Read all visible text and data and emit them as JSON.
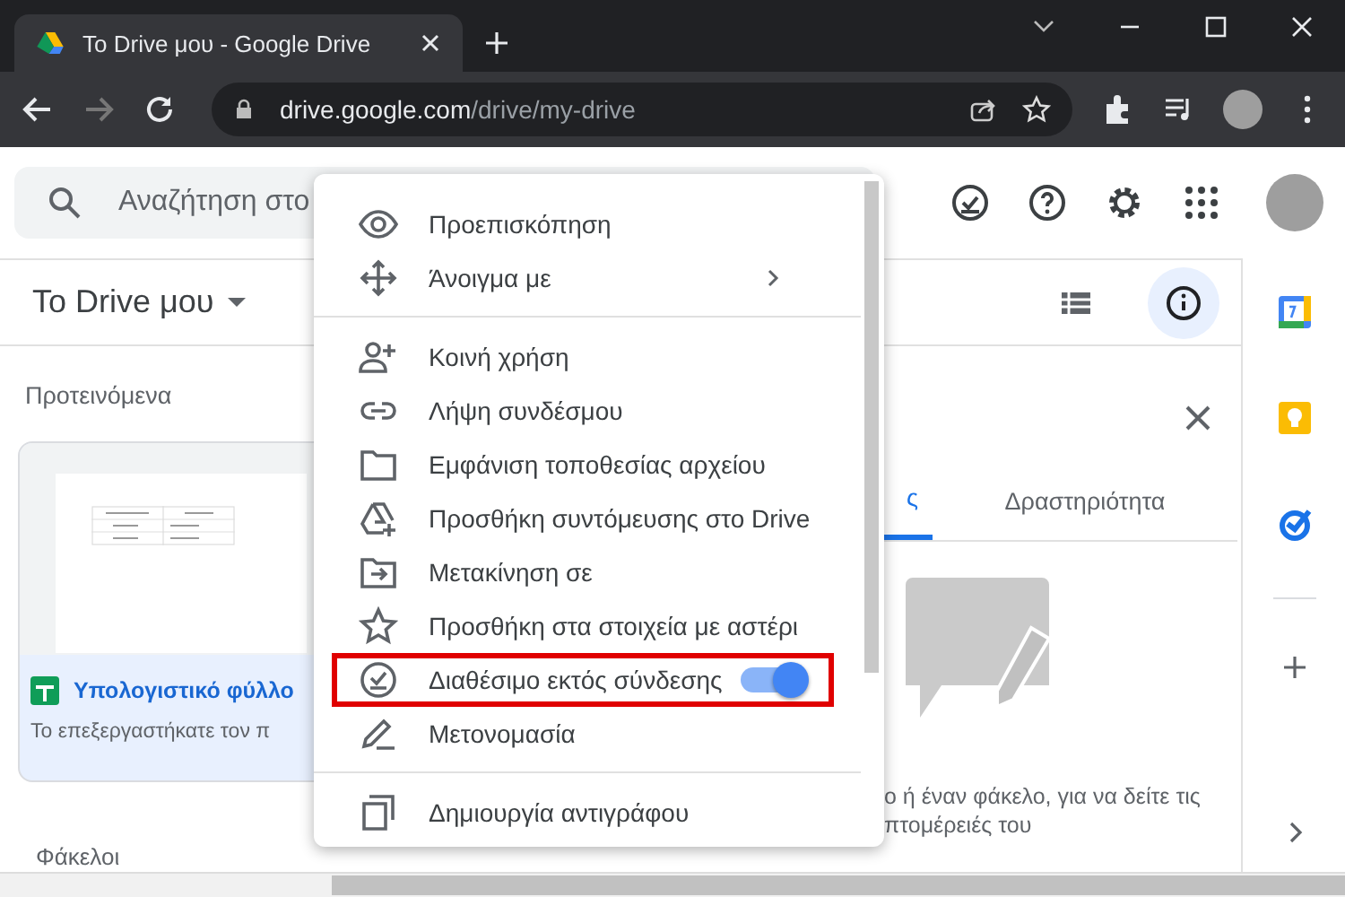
{
  "browser": {
    "tabs": [
      {
        "title": "Το Drive μου - Google Drive",
        "selected": true
      }
    ],
    "address": {
      "domain": "drive.google.com",
      "path": "/drive/my-drive"
    }
  },
  "drive": {
    "search": {
      "placeholder": "Αναζήτηση στο"
    },
    "breadcrumb": "Το Drive μου",
    "suggested_heading": "Προτεινόμενα",
    "card": {
      "title": "Υπολογιστικό φύλλο",
      "subtitle": "Το επεξεργαστήκατε τον π"
    },
    "folders_heading": "Φάκελοι"
  },
  "details": {
    "tabs": [
      {
        "label": "ς",
        "selected": true
      },
      {
        "label": "Δραστηριότητα",
        "selected": false
      }
    ],
    "hint_lines": [
      "ο ή έναν φάκελο, για να δείτε τις",
      "πτομέρειές του"
    ]
  },
  "menu": {
    "groups": [
      [
        {
          "kind": "item",
          "label": "Προεπισκόπηση",
          "highlighted": false
        },
        {
          "kind": "submenu",
          "label": "Άνοιγμα με",
          "highlighted": false
        }
      ],
      [
        {
          "kind": "item",
          "label": "Κοινή χρήση",
          "highlighted": false
        },
        {
          "kind": "item",
          "label": "Λήψη συνδέσμου",
          "highlighted": false
        },
        {
          "kind": "item",
          "label": "Εμφάνιση τοποθεσίας αρχείου",
          "highlighted": false
        },
        {
          "kind": "item",
          "label": "Προσθήκη συντόμευσης στο Drive",
          "highlighted": false
        },
        {
          "kind": "item",
          "label": "Μετακίνηση σε",
          "highlighted": false
        },
        {
          "kind": "item",
          "label": "Προσθήκη στα στοιχεία με αστέρι",
          "highlighted": false
        },
        {
          "kind": "toggle",
          "label": "Διαθέσιμο εκτός σύνδεσης",
          "on": true,
          "highlighted": true
        },
        {
          "kind": "item",
          "label": "Μετονομασία",
          "highlighted": false
        }
      ],
      [
        {
          "kind": "item",
          "label": "Δημιουργία αντιγράφου",
          "highlighted": false
        }
      ]
    ]
  }
}
